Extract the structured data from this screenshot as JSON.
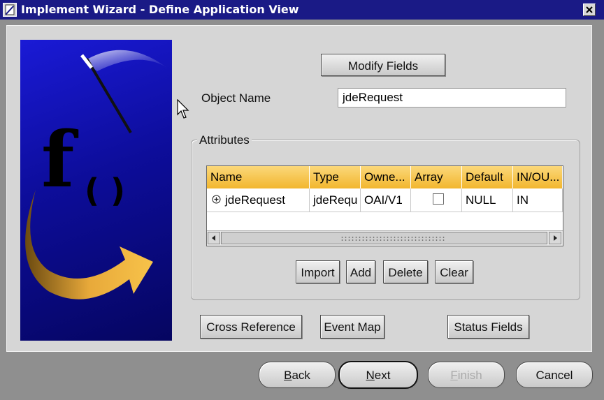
{
  "window": {
    "title": "Implement Wizard - Define Application View"
  },
  "buttons": {
    "modify_fields": "Modify Fields",
    "import": "Import",
    "add": "Add",
    "delete": "Delete",
    "clear": "Clear",
    "cross_reference": "Cross Reference",
    "event_map": "Event Map",
    "status_fields": "Status Fields"
  },
  "object_name": {
    "label": "Object Name",
    "value": "jdeRequest"
  },
  "attributes": {
    "legend": "Attributes",
    "columns": [
      "Name",
      "Type",
      "Owne...",
      "Array",
      "Default",
      "IN/OU..."
    ],
    "rows": [
      {
        "name": "jdeRequest",
        "type": "jdeRequ",
        "owner": "OAI/V1",
        "array": false,
        "default": "NULL",
        "inout": "IN"
      }
    ]
  },
  "footer": {
    "back": {
      "mnemonic": "B",
      "rest": "ack"
    },
    "next": {
      "mnemonic": "N",
      "rest": "ext"
    },
    "finish": {
      "mnemonic": "F",
      "rest": "inish",
      "enabled": false
    },
    "cancel": "Cancel"
  },
  "icons": [
    "app-icon",
    "close-icon",
    "wizard-function-graphic",
    "expand-icon",
    "scroll-left-icon",
    "scroll-right-icon",
    "mouse-cursor-icon"
  ]
}
